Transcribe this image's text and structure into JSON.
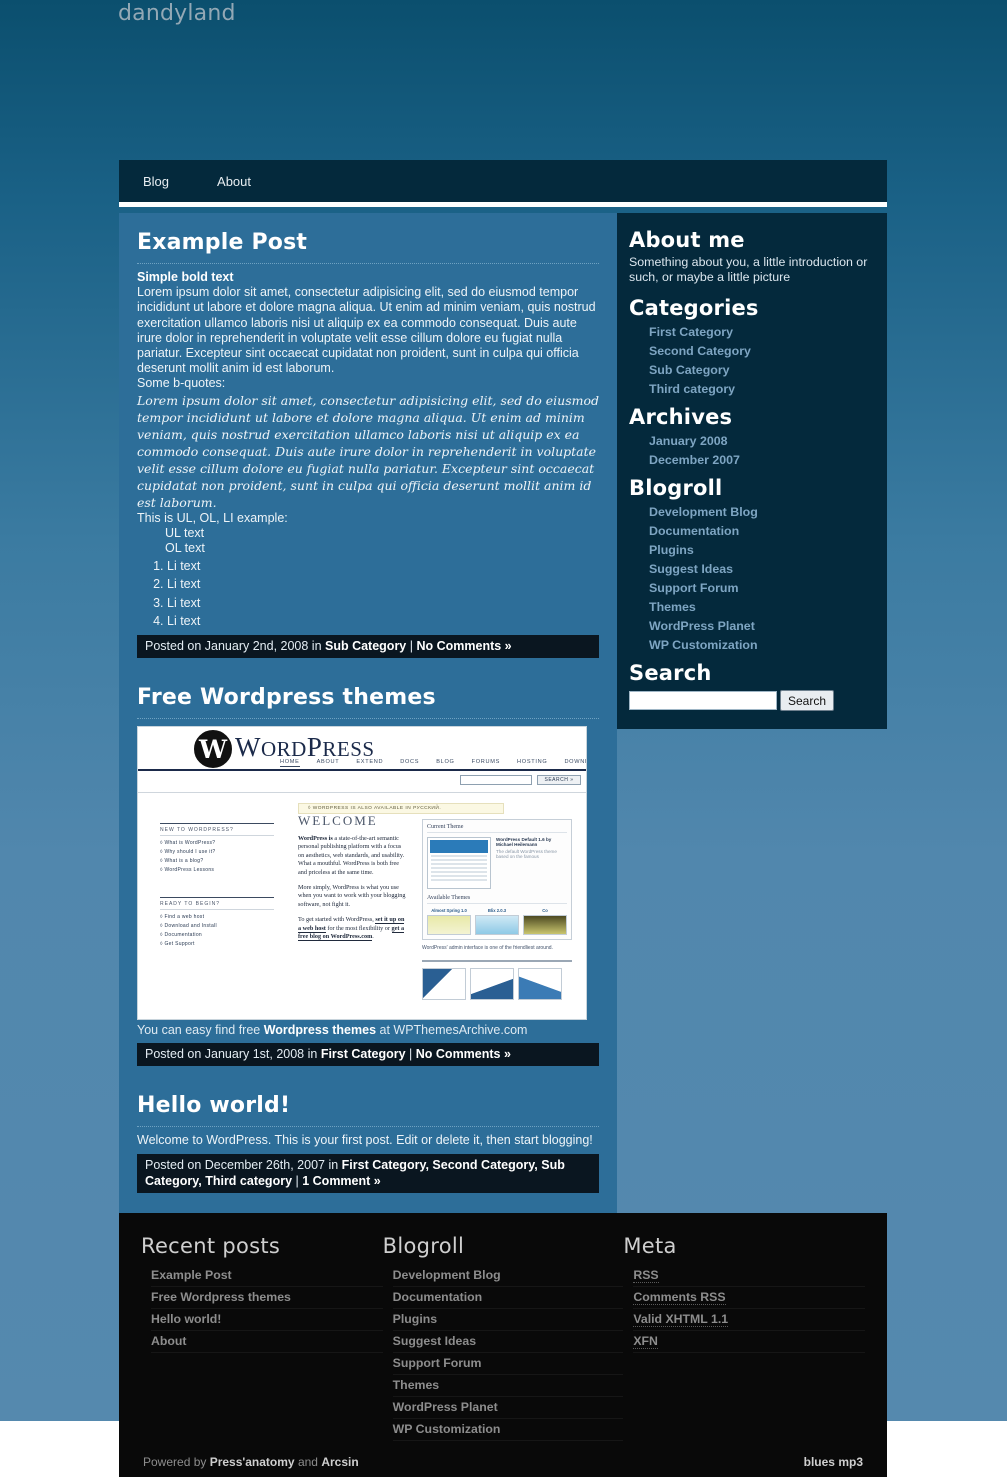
{
  "site": {
    "title": "dandyland"
  },
  "nav": {
    "items": [
      {
        "label": "Blog"
      },
      {
        "label": "About"
      }
    ]
  },
  "posts": [
    {
      "title": "Example Post",
      "bold_lead": "Simple bold text",
      "paragraph": "Lorem ipsum dolor sit amet, consectetur adipisicing elit, sed do eiusmod tempor incididunt ut labore et dolore magna aliqua. Ut enim ad minim veniam, quis nostrud exercitation ullamco laboris nisi ut aliquip ex ea commodo consequat. Duis aute irure dolor in reprehenderit in voluptate velit esse cillum dolore eu fugiat nulla pariatur. Excepteur sint occaecat cupidatat non proident, sunt in culpa qui officia deserunt mollit anim id est laborum.",
      "quote_intro": "Some b-quotes:",
      "blockquote": "Lorem ipsum dolor sit amet, consectetur adipisicing elit, sed do eiusmod tempor incididunt ut labore et dolore magna aliqua. Ut enim ad minim veniam, quis nostrud exercitation ullamco laboris nisi ut aliquip ex ea commodo consequat. Duis aute irure dolor in reprehenderit in voluptate velit esse cillum dolore eu fugiat nulla pariatur. Excepteur sint occaecat cupidatat non proident, sunt in culpa qui officia deserunt mollit anim id est laborum.",
      "list_intro": "This is UL, OL, LI example:",
      "ul_items": [
        "UL text",
        "OL text"
      ],
      "ol_items": [
        "Li text",
        "Li text",
        "Li text",
        "Li text"
      ],
      "meta": {
        "prefix": "Posted on January 2nd, 2008 in ",
        "categories": "Sub Category",
        "separator": " | ",
        "comments": "No Comments »"
      }
    },
    {
      "title": "Free Wordpress themes",
      "caption_pre": "You can easy find free ",
      "caption_bold": "Wordpress themes",
      "caption_post": " at WPThemesArchive.com",
      "meta": {
        "prefix": "Posted on January 1st, 2008 in ",
        "categories": "First Category",
        "separator": " | ",
        "comments": "No Comments »"
      }
    },
    {
      "title": "Hello world!",
      "body": "Welcome to WordPress. This is your first post. Edit or delete it, then start blogging!",
      "meta": {
        "prefix": "Posted on December 26th, 2007 in ",
        "categories": "First Category, Second Category, Sub Category, Third category",
        "separator": " | ",
        "comments": "1 Comment »"
      }
    }
  ],
  "wp_screenshot": {
    "brand_w": "W",
    "wordmark_a": "W",
    "wordmark_b": "ORD",
    "wordmark_c": "P",
    "wordmark_d": "RESS",
    "nav": [
      "HOME",
      "ABOUT",
      "EXTEND",
      "DOCS",
      "BLOG",
      "FORUMS",
      "HOSTING",
      "DOWNLOAD"
    ],
    "search_button": "SEARCH »",
    "notice": "◊ WORDPRESS IS ALSO AVAILABLE IN РУССКИЙ.",
    "left_h1": "NEW TO WORDPRESS?",
    "left_items_1": [
      "◊ What is WordPress?",
      "◊ Why should I use it?",
      "◊ What is a blog?",
      "◊ WordPress Lessons"
    ],
    "left_h2": "READY TO BEGIN?",
    "left_items_2": [
      "◊ Find a web host",
      "◊ Download and Install",
      "◊ Documentation",
      "◊ Get Support"
    ],
    "welcome": "WELCOME",
    "para1_bold": "WordPress is",
    "para1": " a state-of-the-art semantic personal publishing platform with a focus on aesthetics, web standards, and usability. What a mouthful. WordPress is both free and priceless at the same time.",
    "para2": "More simply, WordPress is what you use when you want to work with your blogging software, not fight it.",
    "para3_a": "To get started with WordPress, ",
    "para3_link1": "set it up on a web host",
    "para3_b": " for the most flexibility or ",
    "para3_link2": "get a free blog on WordPress.com",
    "para3_c": ".",
    "panel_h1": "Current Theme",
    "theme_title": "WordPress Default 1.6 by Michael Heilemann",
    "theme_sub": "The default WordPress theme based on the famous",
    "panel_h2": "Available Themes",
    "themes": [
      "Almost Spring 1.0",
      "Blix 2.0.3",
      "Co"
    ],
    "admin_caption": "WordPress' admin interface is one of the friendliest around."
  },
  "sidebar": {
    "about": {
      "heading": "About me",
      "text": "Something about you, a little introduction or such, or maybe a little picture"
    },
    "categories": {
      "heading": "Categories",
      "items": [
        "First Category",
        "Second Category",
        "Sub Category",
        "Third category"
      ]
    },
    "archives": {
      "heading": "Archives",
      "items": [
        "January 2008",
        "December 2007"
      ]
    },
    "blogroll": {
      "heading": "Blogroll",
      "items": [
        "Development Blog",
        "Documentation",
        "Plugins",
        "Suggest Ideas",
        "Support Forum",
        "Themes",
        "WordPress Planet",
        "WP Customization"
      ]
    },
    "search": {
      "heading": "Search",
      "value": "",
      "placeholder": "",
      "button": "Search"
    }
  },
  "footer": {
    "recent": {
      "heading": "Recent posts",
      "items": [
        "Example Post",
        "Free Wordpress themes",
        "Hello world!",
        "About"
      ]
    },
    "blogroll": {
      "heading": "Blogroll",
      "items": [
        "Development Blog",
        "Documentation",
        "Plugins",
        "Suggest Ideas",
        "Support Forum",
        "Themes",
        "WordPress Planet",
        "WP Customization"
      ]
    },
    "meta": {
      "heading": "Meta",
      "items": [
        "RSS",
        "Comments RSS",
        "Valid XHTML 1.1",
        "XFN"
      ]
    },
    "credits_pre": "Powered by ",
    "credits_b1": "Press'anatomy",
    "credits_mid": " and ",
    "credits_b2": "Arcsin",
    "right": "blues mp3"
  },
  "colors": {
    "bg_top": "#0b4f6e",
    "bg_bottom": "#5589ae",
    "panel": "#2d6e99",
    "dark": "#04293c",
    "meta_bar": "#0a1620",
    "link": "#7ea5c2",
    "footer_bg": "#090909"
  }
}
